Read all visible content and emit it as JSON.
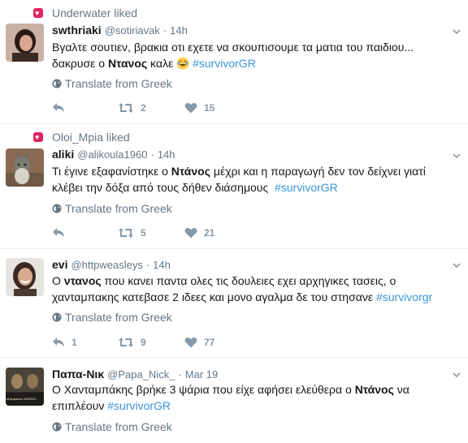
{
  "tweets": [
    {
      "context": "Underwater liked",
      "fullname": "swthriaki",
      "handle": "@sotiriavak",
      "time": "14h",
      "text_line1": "Βγαλτε σουτιεν, βρακια οτι εχετε να σκουπισουμε τα ματια του παιδιου...",
      "text_line2_pre": "δακρυσε ο ",
      "text_line2_bold": "Ντανος",
      "text_line2_post": " καλε ",
      "hashtag": "#survivorGR",
      "translate": "Translate from Greek",
      "retweets": "2",
      "likes": "15"
    },
    {
      "context": "Oloi_Μpia liked",
      "fullname": "aliki",
      "handle": "@alikoula1960",
      "time": "14h",
      "text_line1_pre": "Τι έγινε εξαφανίστηκε ο ",
      "text_line1_bold": "Ντάνος",
      "text_line1_post": " μέχρι και η παραγωγή δεν τον δείχνει γιατί",
      "text_line2": "κλέβει την δόξα από τους δήθεν διάσημους",
      "hashtag": "#survivorGR",
      "translate": "Translate from Greek",
      "retweets": "5",
      "likes": "21"
    },
    {
      "fullname": "evi",
      "handle": "@httpweasleys",
      "time": "14h",
      "text_line1_pre": "Ο ",
      "text_line1_bold": "ντανος",
      "text_line1_post": " που κανει παντα ολες τις δουλειες εχει αρχηγικες τασεις, ο",
      "text_line2": "χανταμπακης κατεβασε 2 ιδεες και μονο αγαλμα δε του στησανε",
      "hashtag": "#survivorgr",
      "translate": "Translate from Greek",
      "replies": "1",
      "retweets": "9",
      "likes": "77"
    },
    {
      "fullname": "Παπα-Νικ",
      "handle": "@Papa_Nick_",
      "time": "Mar 19",
      "text_line1_pre": "Ο Χανταμπάκης βρήκε 3 ψάρια που είχε αφήσει ελεύθερα ο ",
      "text_line1_bold": "Ντάνος",
      "text_line1_post": " να",
      "text_line2": "επιπλέουν",
      "hashtag": "#survivorGR",
      "translate": "Translate from Greek",
      "avatar_caption": "Μπερισκλιν ΜΑΡΑΘ..."
    }
  ],
  "icons": {
    "like_badge": "heart-badge-icon",
    "caret": "chevron-down-icon",
    "globe": "globe-icon",
    "reply": "reply-icon",
    "retweet": "retweet-icon",
    "like": "heart-icon"
  },
  "colors": {
    "hashtag": "#3b94d9",
    "muted": "#657786",
    "like_badge": "#e0245e"
  }
}
